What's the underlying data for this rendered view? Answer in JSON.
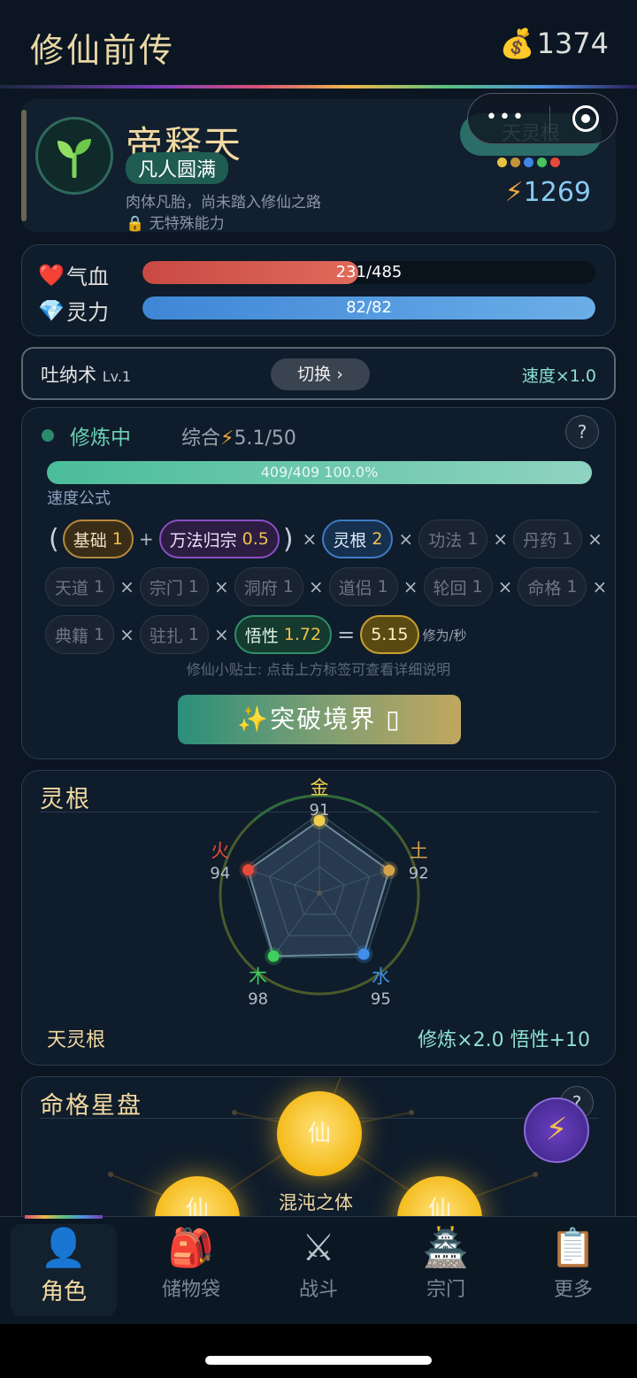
{
  "header": {
    "title": "修仙前传",
    "coin_icon": "money-bag-icon",
    "coins": "1374"
  },
  "profile": {
    "avatar_icon": "sprout-icon",
    "name": "帝释天",
    "realm": "凡人圆满",
    "description": "肉体凡胎，尚未踏入修仙之路",
    "ability": "无特殊能力",
    "root_button": "天灵根",
    "power": "1269",
    "root_colors": [
      "#e8c440",
      "#c4933a",
      "#3f86e8",
      "#47c45c",
      "#e44a3a"
    ]
  },
  "stats": {
    "hp_label": "气血",
    "hp_text": "231/485",
    "hp_fraction": 0.476,
    "mp_label": "灵力",
    "mp_text": "82/82",
    "mp_fraction": 1.0
  },
  "technique": {
    "name": "吐纳术",
    "level": "Lv.1",
    "switch_label": "切换 ›",
    "speed": "速度×1.0"
  },
  "cultivation": {
    "status": "修炼中",
    "combined_label": "综合",
    "combined_value": "5.1/50",
    "progress_text": "409/409  100.0%",
    "progress_fraction": 1.0,
    "formula_label": "速度公式",
    "row1": {
      "base": {
        "label": "基础",
        "value": "1"
      },
      "wanfa": {
        "label": "万法归宗",
        "value": "0.5"
      },
      "root": {
        "label": "灵根",
        "value": "2"
      },
      "gongfa": {
        "label": "功法",
        "value": "1"
      },
      "danyao": {
        "label": "丹药",
        "value": "1"
      }
    },
    "row2": {
      "tiandao": {
        "label": "天道",
        "value": "1"
      },
      "zongmen": {
        "label": "宗门",
        "value": "1"
      },
      "dongfu": {
        "label": "洞府",
        "value": "1"
      },
      "daolv": {
        "label": "道侣",
        "value": "1"
      },
      "lunhui": {
        "label": "轮回",
        "value": "1"
      },
      "mingge": {
        "label": "命格",
        "value": "1"
      }
    },
    "row3": {
      "dianji": {
        "label": "典籍",
        "value": "1"
      },
      "zhuzha": {
        "label": "驻扎",
        "value": "1"
      },
      "wuxing": {
        "label": "悟性",
        "value": "1.72"
      },
      "result": "5.15",
      "unit": "修为/秒"
    },
    "tip": "修仙小贴士: 点击上方标签可查看详细说明",
    "breakthrough": "✨突破境界 ▯"
  },
  "roots": {
    "title": "灵根",
    "elements": [
      {
        "name": "金",
        "value": 91,
        "display": "91",
        "color": "#f0cf4a"
      },
      {
        "name": "土",
        "value": 92,
        "display": "92",
        "color": "#d4a24a"
      },
      {
        "name": "水",
        "value": 95,
        "display": "95",
        "color": "#3f8ee8"
      },
      {
        "name": "木",
        "value": 98,
        "display": "98",
        "color": "#3fcf5c"
      },
      {
        "name": "火",
        "value": 94,
        "display": "94",
        "color": "#e84a3a"
      }
    ],
    "type": "天灵根",
    "bonus": "修炼×2.0  悟性+10"
  },
  "fate": {
    "title": "命格星盘",
    "orb_label": "仙",
    "center_label": "混沌之体"
  },
  "tabs": [
    {
      "icon": "person-icon",
      "glyph": "👤",
      "label": "角色"
    },
    {
      "icon": "backpack-icon",
      "glyph": "🎒",
      "label": "储物袋"
    },
    {
      "icon": "swords-icon",
      "glyph": "⚔",
      "label": "战斗"
    },
    {
      "icon": "temple-icon",
      "glyph": "🏯",
      "label": "宗门"
    },
    {
      "icon": "clipboard-icon",
      "glyph": "📋",
      "label": "更多"
    }
  ]
}
